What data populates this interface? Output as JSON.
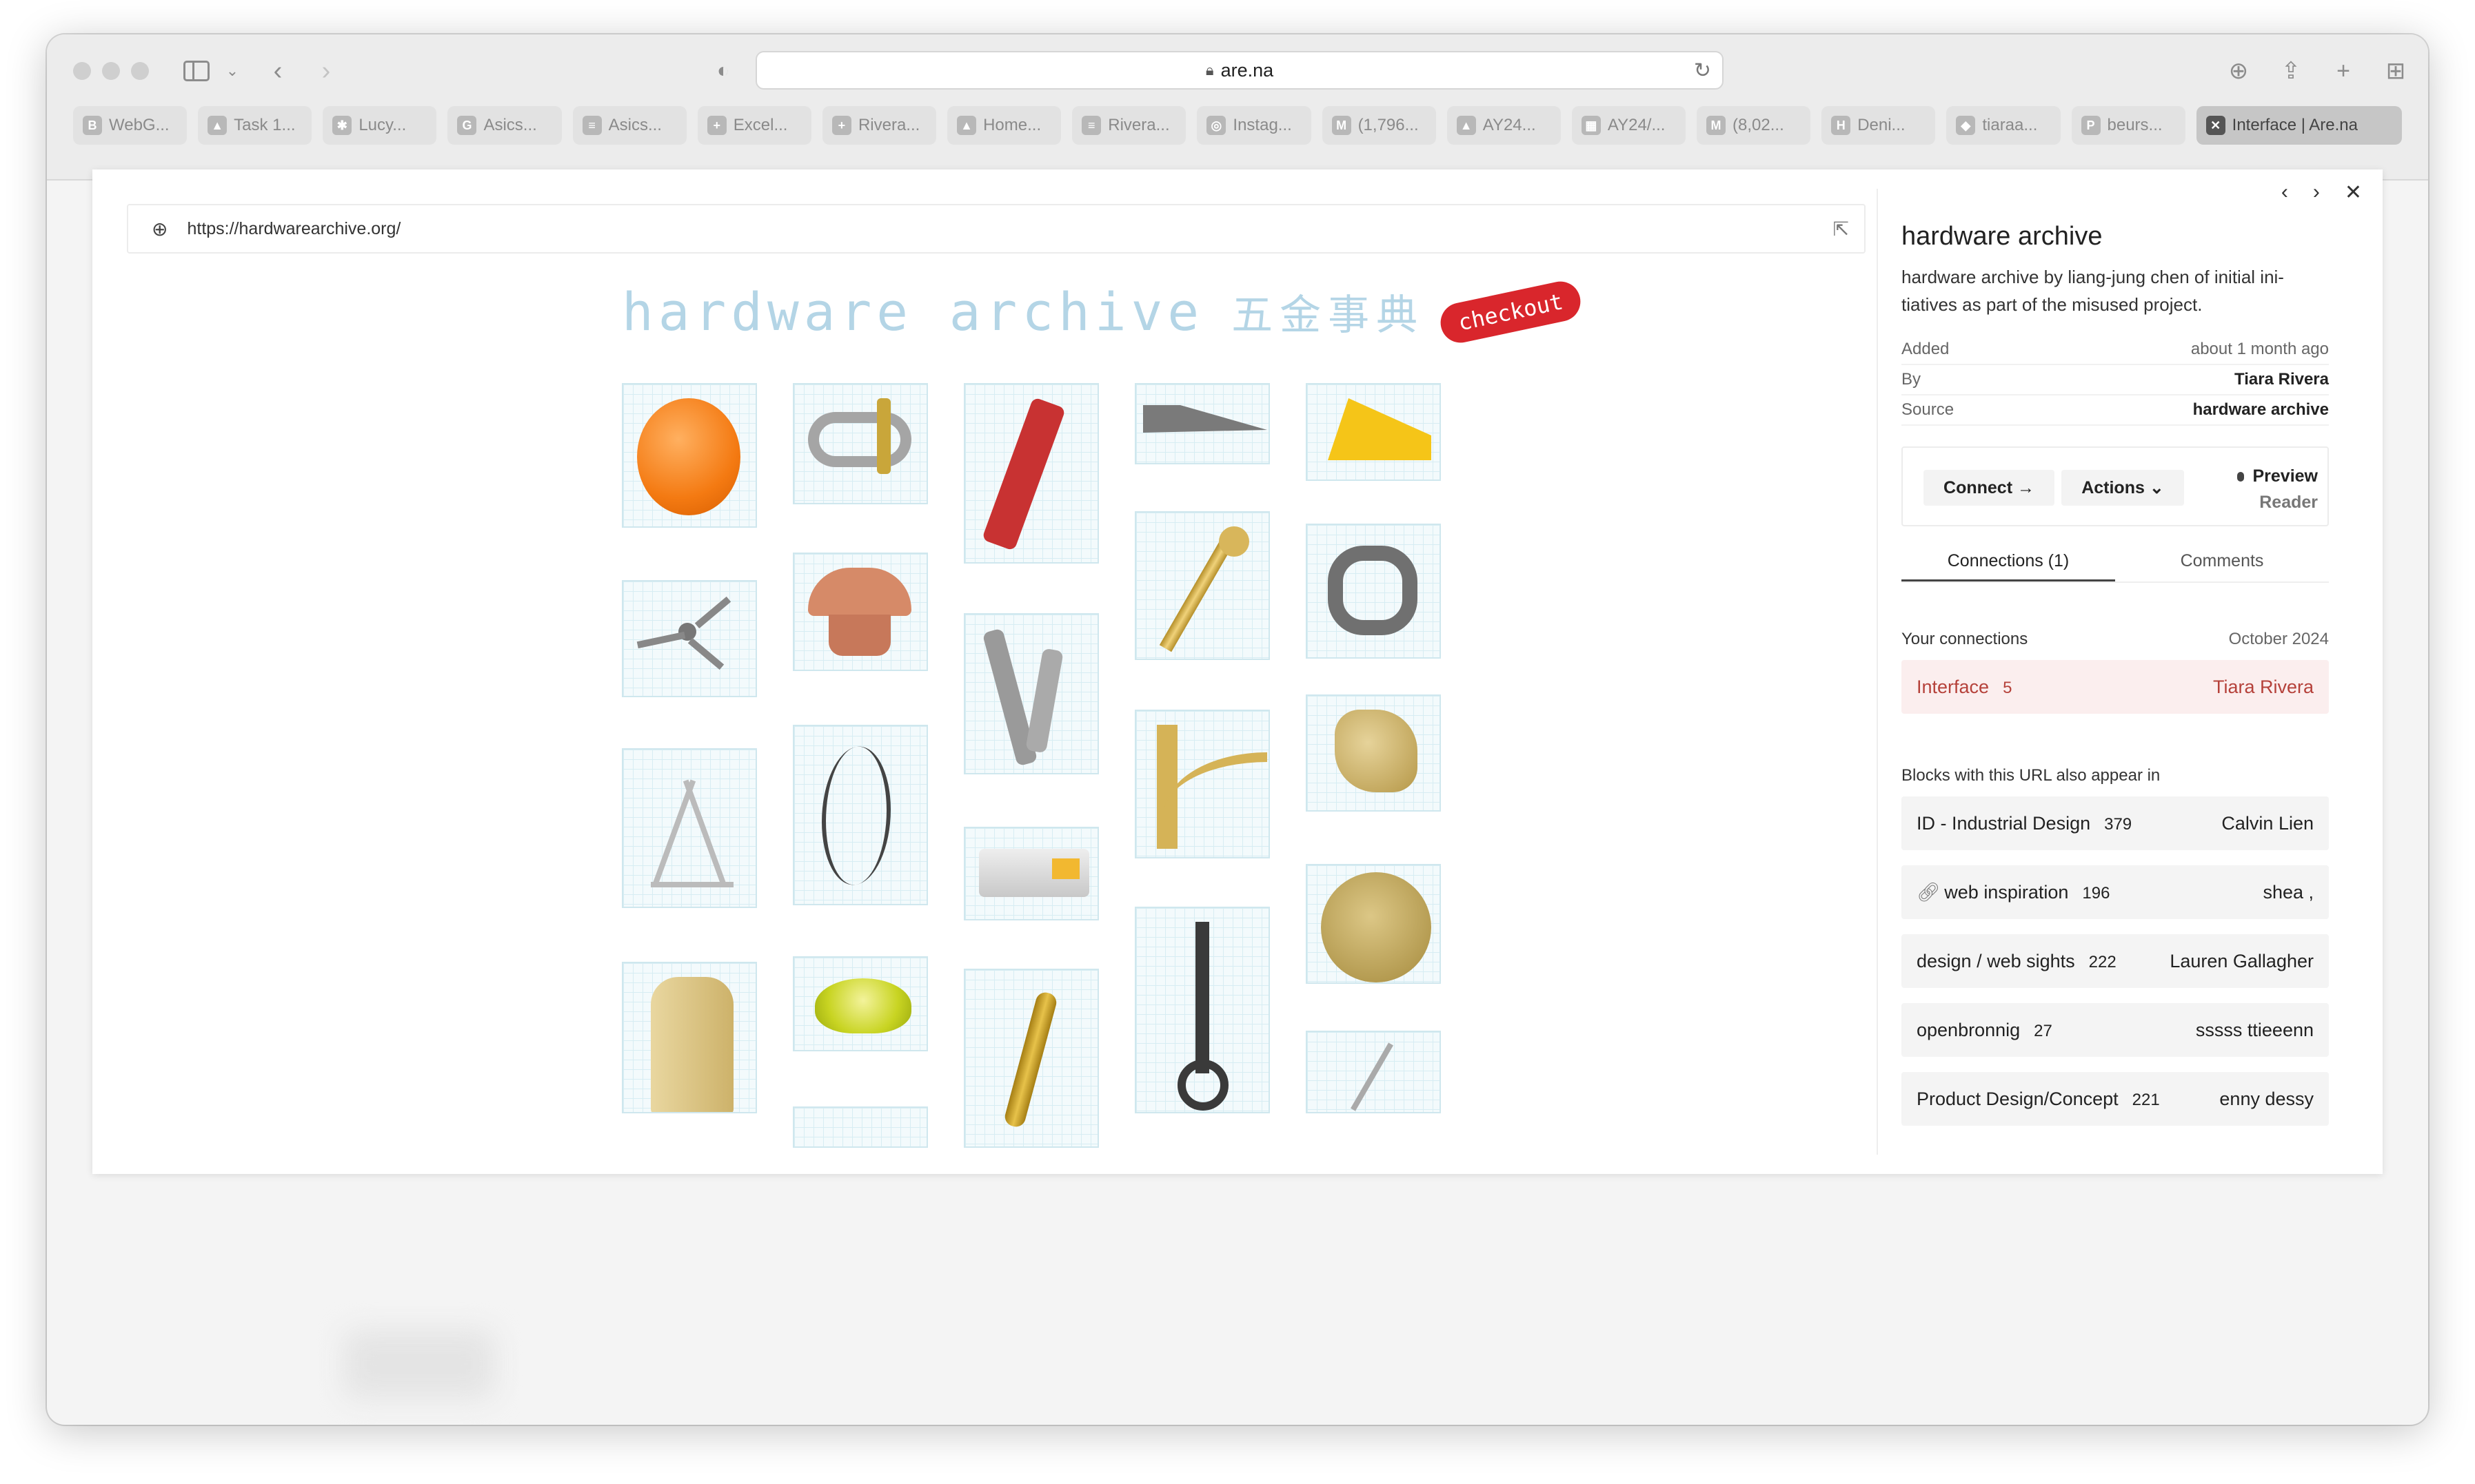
{
  "browser": {
    "address": "are.na",
    "tabs": [
      {
        "icon": "B",
        "label": "WebG..."
      },
      {
        "icon": "▲",
        "label": "Task 1..."
      },
      {
        "icon": "✱",
        "label": "Lucy..."
      },
      {
        "icon": "G",
        "label": "Asics..."
      },
      {
        "icon": "≡",
        "label": "Asics..."
      },
      {
        "icon": "+",
        "label": "Excel..."
      },
      {
        "icon": "+",
        "label": "Rivera..."
      },
      {
        "icon": "▲",
        "label": "Home..."
      },
      {
        "icon": "≡",
        "label": "Rivera..."
      },
      {
        "icon": "◎",
        "label": "Instag..."
      },
      {
        "icon": "M",
        "label": "(1,796..."
      },
      {
        "icon": "▲",
        "label": "AY24..."
      },
      {
        "icon": "▦",
        "label": "AY24/..."
      },
      {
        "icon": "M",
        "label": "(8,02..."
      },
      {
        "icon": "H",
        "label": "Deni..."
      },
      {
        "icon": "◆",
        "label": "tiaraa..."
      },
      {
        "icon": "P",
        "label": "beurs..."
      },
      {
        "icon": "✕",
        "label": "Interface | Are.na"
      }
    ]
  },
  "preview": {
    "url": "https://hardwarearchive.org/",
    "site_title": "hardware archive",
    "site_title_cjk": "五金事典",
    "checkout_label": "checkout"
  },
  "panel": {
    "title": "hardware archive",
    "description": "hardware archive by liang-jung chen of initial ini-tiatives as part of the misused project.",
    "meta": [
      {
        "key": "Added",
        "value": "about 1 month ago"
      },
      {
        "key": "By",
        "value": "Tiara Rivera"
      },
      {
        "key": "Source",
        "value": "hardware archive"
      }
    ],
    "connect_label": "Connect →",
    "actions_label": "Actions ⌄",
    "view_preview": "Preview",
    "view_reader": "Reader",
    "tab_connections": "Connections (1)",
    "tab_comments": "Comments",
    "your_connections_label": "Your connections",
    "your_connections_date": "October 2024",
    "my_connection": {
      "channel": "Interface",
      "count": "5",
      "owner": "Tiara Rivera"
    },
    "also_appear_label": "Blocks with this URL also appear in",
    "also_appear": [
      {
        "channel": "ID - Industrial Design",
        "count": "379",
        "owner": "Calvin Lien"
      },
      {
        "channel": "web inspiration",
        "count": "196",
        "owner": "shea ,"
      },
      {
        "channel": "design / web sights",
        "count": "222",
        "owner": "Lauren Gallagher"
      },
      {
        "channel": "openbronnig",
        "count": "27",
        "owner": "sssss ttieeenn"
      },
      {
        "channel": "Product Design/Concept",
        "count": "221",
        "owner": "enny dessy"
      }
    ]
  },
  "colors": {
    "accent_red": "#b5413a",
    "checkout_red": "#d9262c",
    "site_blue": "#b4d5e6"
  },
  "icons": [
    "sidebar-icon",
    "back-icon",
    "forward-icon",
    "shield-icon",
    "lock-icon",
    "reload-icon",
    "download-icon",
    "share-icon",
    "new-tab-icon",
    "tab-overview-icon",
    "globe-icon",
    "external-link-icon",
    "chevron-left-icon",
    "chevron-right-icon",
    "close-icon",
    "link-icon"
  ]
}
